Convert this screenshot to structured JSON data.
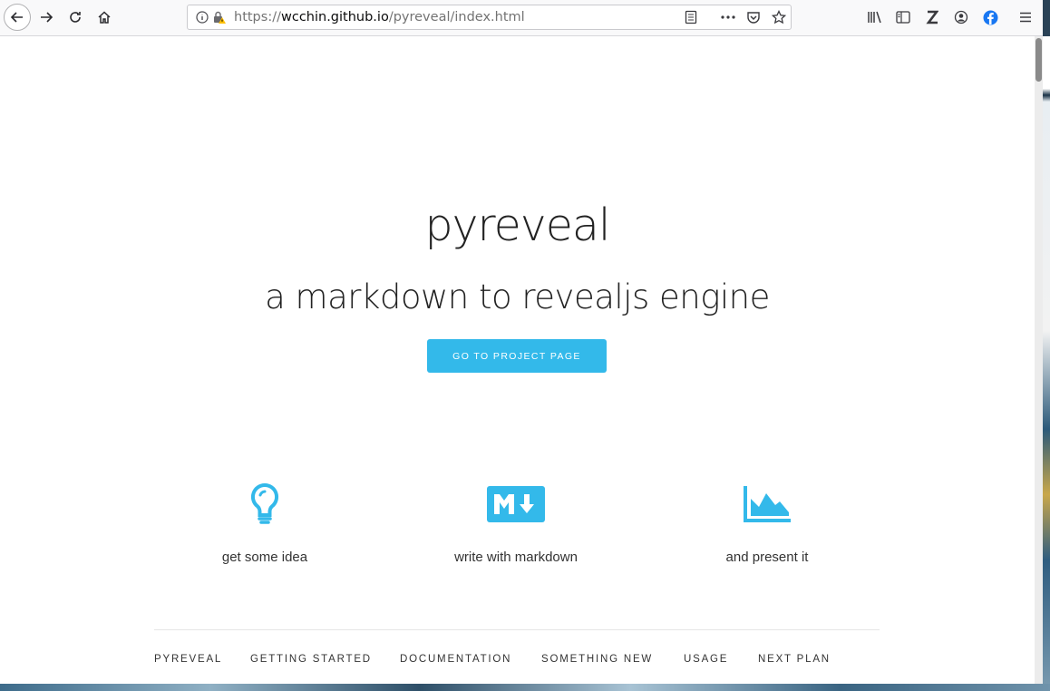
{
  "browser": {
    "url_scheme": "https://",
    "url_host": "wcchin.github.io",
    "url_path": "/pyreveal/index.html",
    "icons": [
      "back-icon",
      "forward-icon",
      "reload-icon",
      "home-icon",
      "info-icon",
      "insecure-lock-icon",
      "reader-view-icon",
      "page-actions-icon",
      "pocket-icon",
      "bookmark-star-icon",
      "library-icon",
      "sidebar-icon",
      "zotero-icon",
      "account-icon",
      "facebook-icon",
      "hamburger-menu-icon"
    ]
  },
  "hero": {
    "title": "pyreveal",
    "subtitle": "a markdown to revealjs engine",
    "cta_label": "GO TO PROJECT PAGE"
  },
  "features": [
    {
      "label": "get some idea",
      "icon": "lightbulb-icon"
    },
    {
      "label": "write with markdown",
      "icon": "markdown-icon"
    },
    {
      "label": "and present it",
      "icon": "area-chart-icon"
    }
  ],
  "nav": [
    "PYREVEAL",
    "GETTING STARTED",
    "DOCUMENTATION",
    "SOMETHING NEW",
    "USAGE",
    "NEXT PLAN"
  ],
  "colors": {
    "accent": "#33b9ea",
    "text": "#222222"
  }
}
